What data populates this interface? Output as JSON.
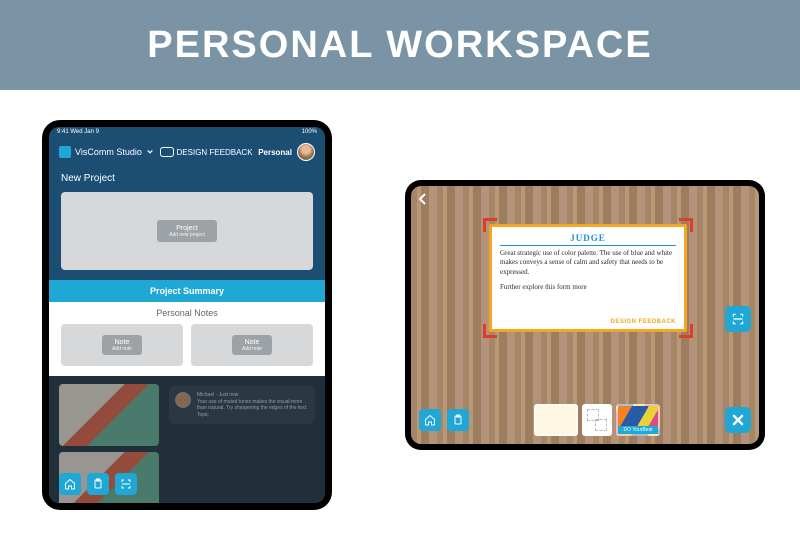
{
  "banner": {
    "title": "PERSONAL WORKSPACE"
  },
  "left": {
    "status": {
      "time": "9:41 Wed Jan 9",
      "icons": "100%"
    },
    "appbar": {
      "studio_name": "VisComm Studio",
      "logo_label": "DESIGN FEEDBACK",
      "personal_label": "Personal"
    },
    "new_project": {
      "section_label": "New Project",
      "button_label": "Project",
      "button_sub": "Add new project"
    },
    "summary_label": "Project Summary",
    "notes": {
      "title": "Personal Notes",
      "note_label": "Note",
      "note_sub": "Add note"
    },
    "feedback": {
      "author": "Michael",
      "time": "Just now",
      "text": "Your use of muted tones makes the visual more than natural. Try sharpening the edges of the text.",
      "topic": "Topic"
    }
  },
  "right": {
    "note": {
      "heading": "JUDGE",
      "line1": "Great strategic use of color palette. The use of blue and white makes conveys a sense of calm and safety that needs to be expressed.",
      "line2": "Further explore this form more",
      "brand": "DESIGN FEEDBACK"
    },
    "thumbs": {
      "caption": "DO YourBest"
    }
  }
}
